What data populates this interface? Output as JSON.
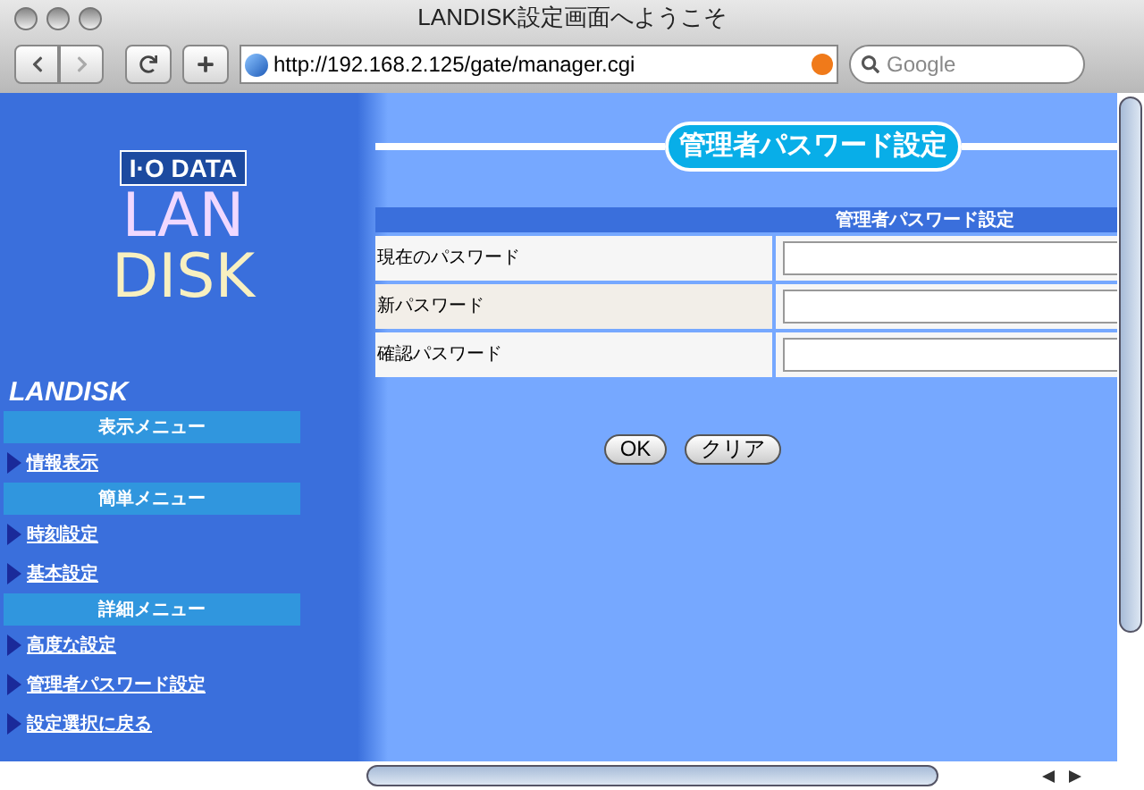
{
  "window": {
    "title": "LANDISK設定画面へようこそ"
  },
  "toolbar": {
    "url": "http://192.168.2.125/gate/manager.cgi",
    "search": {
      "placeholder": "Google"
    }
  },
  "sidebar": {
    "logo": {
      "brand": "I·O DATA",
      "line_1": "LAN",
      "line_2": "DISK"
    },
    "heading": "LANDISK",
    "sections": [
      {
        "header": "表示メニュー",
        "items": [
          "情報表示"
        ]
      },
      {
        "header": "簡単メニュー",
        "items": [
          "時刻設定",
          "基本設定"
        ]
      },
      {
        "header": "詳細メニュー",
        "items": [
          "高度な設定",
          "管理者パスワード設定",
          "設定選択に戻る"
        ]
      }
    ]
  },
  "main": {
    "title": "管理者パスワード設定",
    "form": {
      "header": "管理者パスワード設定",
      "rows": [
        {
          "label": "現在のパスワード",
          "shaded": false
        },
        {
          "label": "新パスワード",
          "shaded": true
        },
        {
          "label": "確認パスワード",
          "shaded": false
        }
      ]
    },
    "buttons": [
      "OK",
      "クリア"
    ]
  }
}
